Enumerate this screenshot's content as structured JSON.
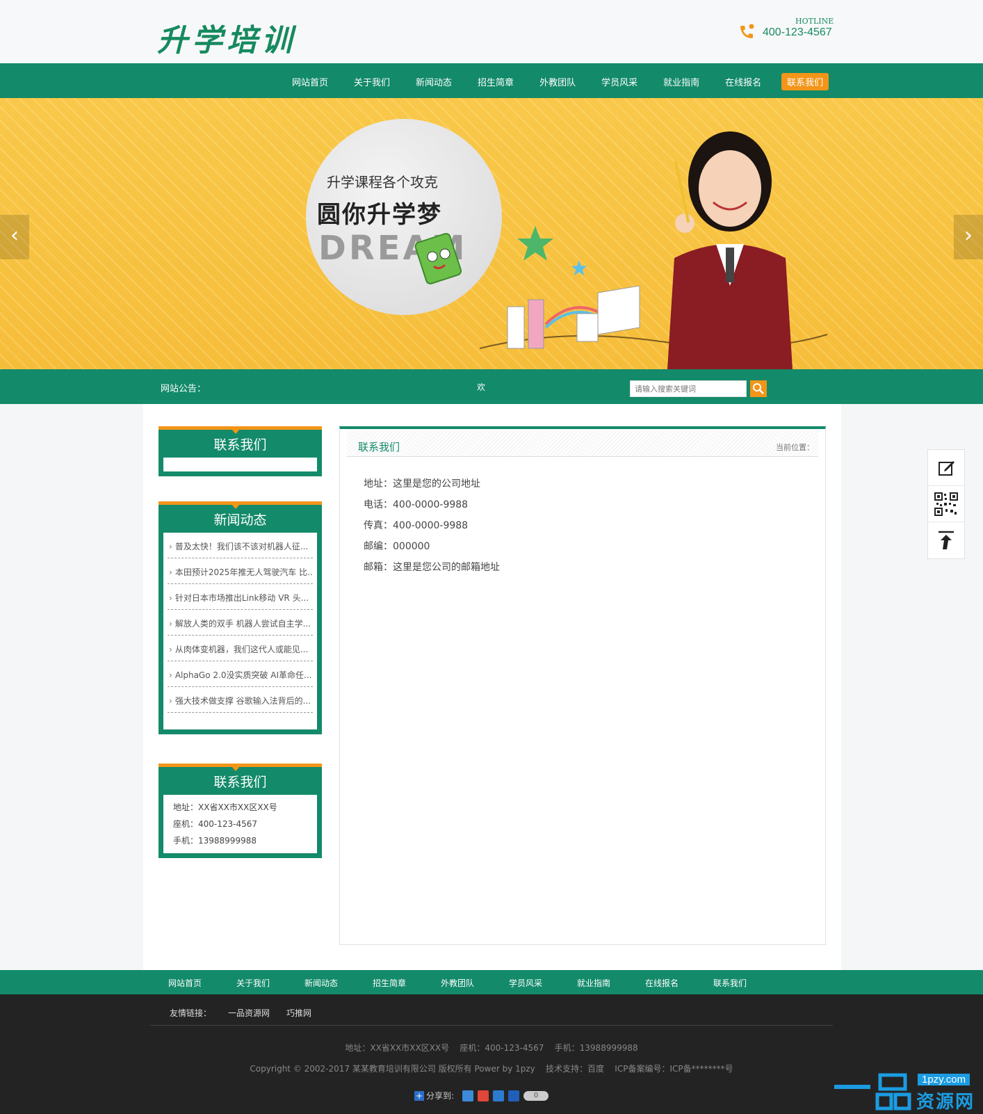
{
  "header": {
    "logo_text": "升学培训",
    "hotline_label": "HOTLINE",
    "hotline_number": "400-123-4567"
  },
  "nav": {
    "items": [
      "网站首页",
      "关于我们",
      "新闻动态",
      "招生简章",
      "外教团队",
      "学员风采",
      "就业指南",
      "在线报名",
      "联系我们"
    ],
    "active_index": 8
  },
  "banner": {
    "subtitle": "升学课程各个攻克",
    "title": "圆你升学梦",
    "dream": "DREAM",
    "prev_arrow": "‹",
    "next_arrow": "›"
  },
  "notice": {
    "label": "网站公告：",
    "text": "欢",
    "search_placeholder": "请输入搜索关键词"
  },
  "sidebar": {
    "box1_title": "联系我们",
    "news_title": "新闻动态",
    "news_items": [
      "普及太快！我们该不该对机器人征...",
      "本田预计2025年推无人驾驶汽车 比...",
      "针对日本市场推出Link移动 VR 头...",
      "解放人类的双手 机器人尝试自主学...",
      "从肉体变机器，我们这代人或能见...",
      "AlphaGo 2.0没实质突破 AI革命任...",
      "强大技术做支撑 谷歌输入法背后的..."
    ],
    "contact_title": "联系我们",
    "contact_lines": [
      "地址：XX省XX市XX区XX号",
      "座机：400-123-4567",
      "手机：13988999988"
    ]
  },
  "content": {
    "title": "联系我们",
    "breadcrumb": "当前位置：",
    "info": [
      "地址：这里是您的公司地址",
      "电话：400-0000-9988",
      "传真：400-0000-9988",
      "邮编：000000",
      "邮箱：这里是您公司的邮箱地址"
    ]
  },
  "footer_nav": [
    "网站首页",
    "关于我们",
    "新闻动态",
    "招生简章",
    "外教团队",
    "学员风采",
    "就业指南",
    "在线报名",
    "联系我们"
  ],
  "footer": {
    "links_label": "友情链接：",
    "links": [
      "一品资源网",
      "巧推网"
    ],
    "address": "地址：XX省XX市XX区XX号    座机：400-123-4567    手机：13988999988",
    "copyright": "Copyright © 2002-2017 某某教育培训有限公司 版权所有 Power by 1pzy    技术支持：百度    ICP备案编号：ICP备********号",
    "share_label": "分享到:",
    "share_count": "0"
  },
  "watermark": {
    "url": "1pzy.com",
    "text": "资源网"
  },
  "colors": {
    "primary_green": "#138a6a",
    "accent_orange": "#f39519",
    "banner_yellow": "#f9c84a",
    "footer_dark": "#232323"
  }
}
